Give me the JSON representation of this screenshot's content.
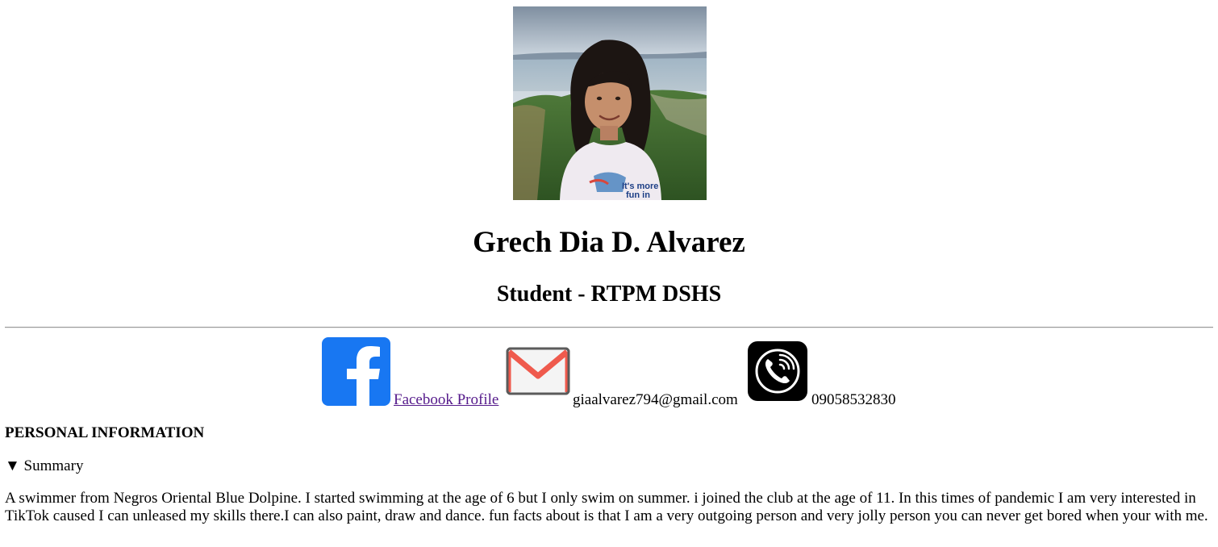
{
  "profile": {
    "name": "Grech Dia D. Alvarez",
    "role": "Student - RTPM DSHS",
    "photo_icon": "profile-photo"
  },
  "contacts": {
    "facebook": {
      "icon": "facebook-icon",
      "label": "Facebook Profile ",
      "color": "#1877F2"
    },
    "email": {
      "icon": "mail-icon",
      "value": "giaalvarez794@gmail.com",
      "color": "#EA4335"
    },
    "phone": {
      "icon": "phone-icon",
      "value": "09058532830",
      "color": "#000000"
    }
  },
  "personal_info": {
    "title": "PERSONAL INFORMATION",
    "summary_label": "▼ Summary",
    "summary_text": "A swimmer from Negros Oriental Blue Dolpine. I started swimming at the age of 6 but I only swim on summer. i joined the club at the age of 11. In this times of pandemic I am very interested in TikTok caused I can unleased my skills there.I can also paint, draw and dance. fun facts about is that I am a very outgoing person and very jolly person you can never get bored when your with me."
  }
}
